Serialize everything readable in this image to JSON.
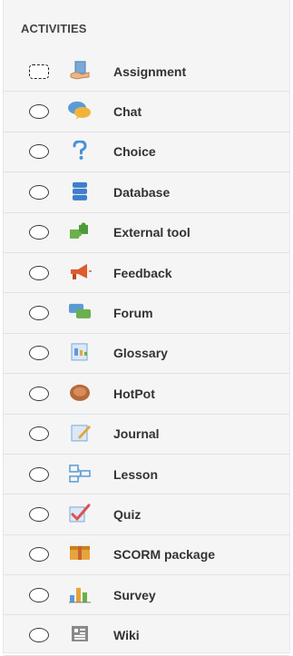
{
  "section": {
    "heading": "ACTIVITIES"
  },
  "activities": [
    {
      "label": "Assignment",
      "icon": "assignment-icon"
    },
    {
      "label": "Chat",
      "icon": "chat-icon"
    },
    {
      "label": "Choice",
      "icon": "question-icon"
    },
    {
      "label": "Database",
      "icon": "database-icon"
    },
    {
      "label": "External tool",
      "icon": "puzzle-icon"
    },
    {
      "label": "Feedback",
      "icon": "megaphone-icon"
    },
    {
      "label": "Forum",
      "icon": "forum-icon"
    },
    {
      "label": "Glossary",
      "icon": "glossary-icon"
    },
    {
      "label": "HotPot",
      "icon": "hotpot-icon"
    },
    {
      "label": "Journal",
      "icon": "journal-icon"
    },
    {
      "label": "Lesson",
      "icon": "lesson-icon"
    },
    {
      "label": "Quiz",
      "icon": "quiz-checkmark-icon"
    },
    {
      "label": "SCORM package",
      "icon": "package-icon"
    },
    {
      "label": "Survey",
      "icon": "bar-chart-icon"
    },
    {
      "label": "Wiki",
      "icon": "wiki-icon"
    }
  ]
}
